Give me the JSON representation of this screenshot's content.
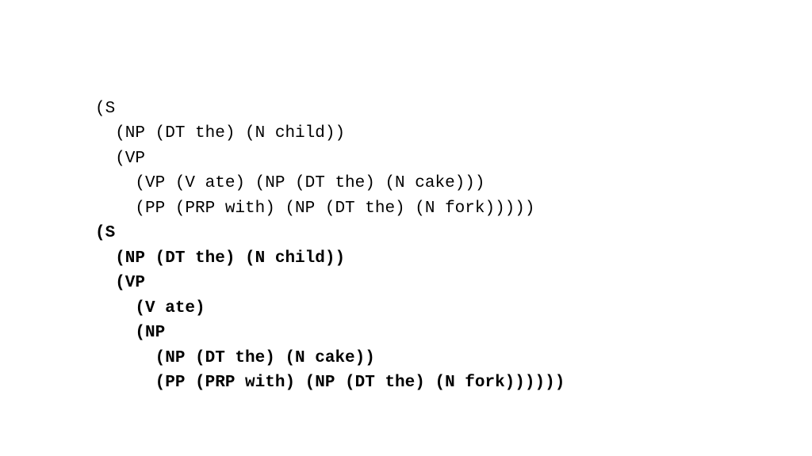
{
  "parse1": {
    "line1": "(S",
    "line2": "  (NP (DT the) (N child))",
    "line3": "  (VP",
    "line4": "    (VP (V ate) (NP (DT the) (N cake)))",
    "line5": "    (PP (PRP with) (NP (DT the) (N fork)))))"
  },
  "parse2": {
    "line1": "(S",
    "line2": "  (NP (DT the) (N child))",
    "line3": "  (VP",
    "line4": "    (V ate)",
    "line5": "    (NP",
    "line6": "      (NP (DT the) (N cake))",
    "line7": "      (PP (PRP with) (NP (DT the) (N fork))))))"
  }
}
